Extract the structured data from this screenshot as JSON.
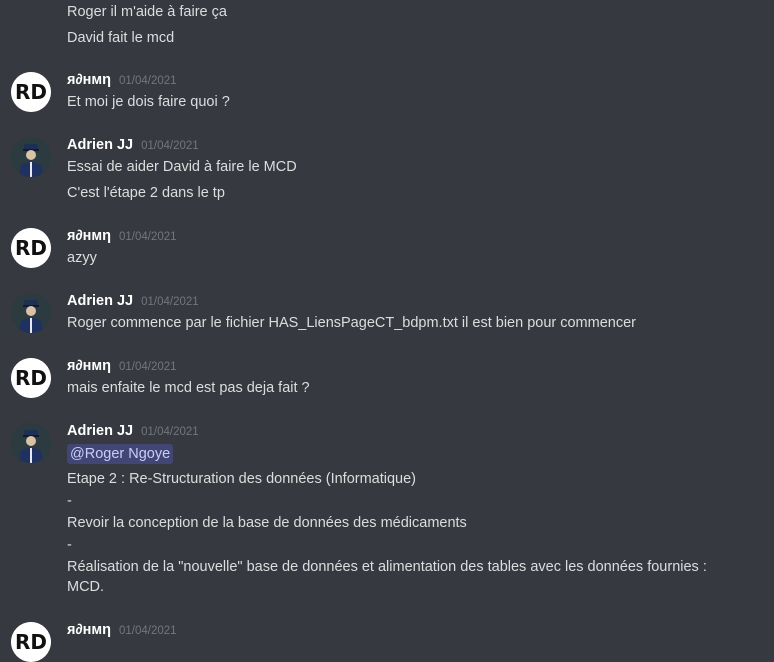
{
  "users": {
    "rd": {
      "name": "я∂нмη",
      "avatar_icon": "rd-logo-avatar"
    },
    "aj": {
      "name": "Adrien JJ",
      "avatar_icon": "officer-avatar"
    }
  },
  "messages": [
    {
      "lines": [
        "Roger il m'aide à faire ça",
        "David fait le mcd"
      ]
    },
    {
      "author": "я∂нмη",
      "time": "01/04/2021",
      "lines": [
        "Et moi je dois faire quoi ?"
      ]
    },
    {
      "author": "Adrien JJ",
      "time": "01/04/2021",
      "lines": [
        "Essai de aider David à faire le MCD",
        "C'est l'étape 2 dans le tp"
      ]
    },
    {
      "author": "я∂нмη",
      "time": "01/04/2021",
      "lines": [
        "azyy"
      ]
    },
    {
      "author": "Adrien JJ",
      "time": "01/04/2021",
      "lines": [
        "Roger commence par le fichier HAS_LiensPageCT_bdpm.txt il est bien pour commencer"
      ]
    },
    {
      "author": "я∂нмη",
      "time": "01/04/2021",
      "lines": [
        "mais enfaite le mcd est pas deja fait ?"
      ]
    },
    {
      "author": "Adrien JJ",
      "time": "01/04/2021",
      "mention": "@Roger Ngoye",
      "lines": [
        "Etape 2 : Re-Structuration des données (Informatique)",
        "-",
        "Revoir la conception de la base de données des médicaments",
        "-",
        "Réalisation de la \"nouvelle\" base de données et alimentation des tables avec les données fournies : MCD."
      ]
    },
    {
      "author": "я∂нмη",
      "time": "01/04/2021",
      "lines": []
    }
  ],
  "colors": {
    "background": "#36393f",
    "text": "#dcddde",
    "timestamp": "#72767d",
    "mention_bg": "#414675",
    "mention_text": "#c9cdfb"
  }
}
